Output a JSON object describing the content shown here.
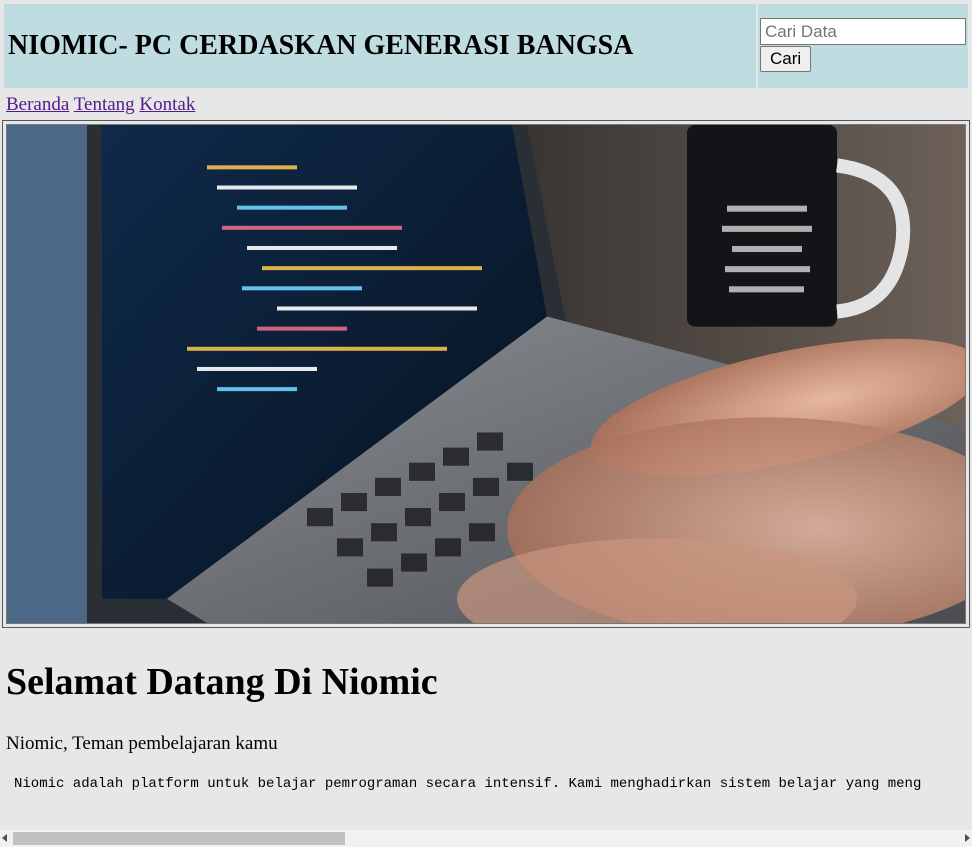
{
  "header": {
    "title": "NIOMIC- PC CERDASKAN GENERASI BANGSA",
    "search_placeholder": "Cari Data",
    "search_value": "",
    "search_button": "Cari"
  },
  "nav": {
    "items": [
      "Beranda",
      "Tentang",
      "Kontak"
    ]
  },
  "hero": {
    "image": "laptop-coding-photo"
  },
  "content": {
    "heading": "Selamat Datang Di Niomic",
    "tagline": "Niomic, Teman pembelajaran kamu",
    "description": "Niomic adalah platform untuk belajar pemrograman secara intensif. Kami menghadirkan sistem belajar yang meng"
  },
  "colors": {
    "header_bg": "#bfdde1",
    "page_bg": "#e7e7e7",
    "visited_link": "#551a8b"
  }
}
